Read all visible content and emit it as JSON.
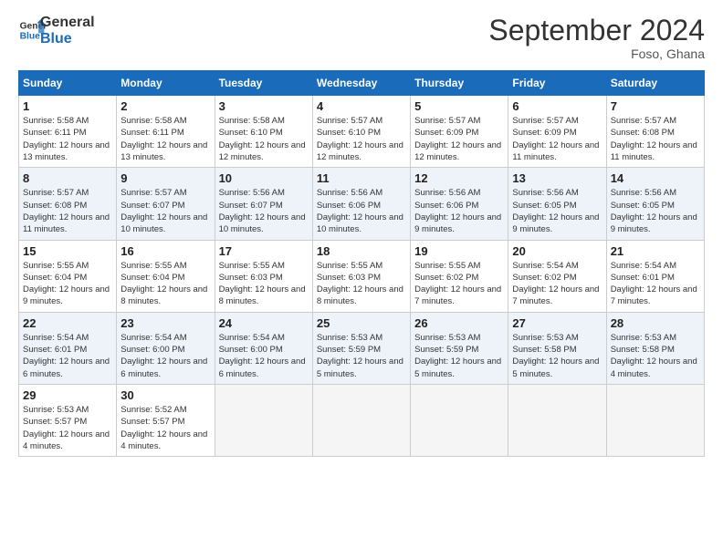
{
  "header": {
    "logo_line1": "General",
    "logo_line2": "Blue",
    "month": "September 2024",
    "location": "Foso, Ghana"
  },
  "weekdays": [
    "Sunday",
    "Monday",
    "Tuesday",
    "Wednesday",
    "Thursday",
    "Friday",
    "Saturday"
  ],
  "weeks": [
    [
      {
        "day": "1",
        "sunrise": "5:58 AM",
        "sunset": "6:11 PM",
        "daylight": "12 hours and 13 minutes."
      },
      {
        "day": "2",
        "sunrise": "5:58 AM",
        "sunset": "6:11 PM",
        "daylight": "12 hours and 13 minutes."
      },
      {
        "day": "3",
        "sunrise": "5:58 AM",
        "sunset": "6:10 PM",
        "daylight": "12 hours and 12 minutes."
      },
      {
        "day": "4",
        "sunrise": "5:57 AM",
        "sunset": "6:10 PM",
        "daylight": "12 hours and 12 minutes."
      },
      {
        "day": "5",
        "sunrise": "5:57 AM",
        "sunset": "6:09 PM",
        "daylight": "12 hours and 12 minutes."
      },
      {
        "day": "6",
        "sunrise": "5:57 AM",
        "sunset": "6:09 PM",
        "daylight": "12 hours and 11 minutes."
      },
      {
        "day": "7",
        "sunrise": "5:57 AM",
        "sunset": "6:08 PM",
        "daylight": "12 hours and 11 minutes."
      }
    ],
    [
      {
        "day": "8",
        "sunrise": "5:57 AM",
        "sunset": "6:08 PM",
        "daylight": "12 hours and 11 minutes."
      },
      {
        "day": "9",
        "sunrise": "5:57 AM",
        "sunset": "6:07 PM",
        "daylight": "12 hours and 10 minutes."
      },
      {
        "day": "10",
        "sunrise": "5:56 AM",
        "sunset": "6:07 PM",
        "daylight": "12 hours and 10 minutes."
      },
      {
        "day": "11",
        "sunrise": "5:56 AM",
        "sunset": "6:06 PM",
        "daylight": "12 hours and 10 minutes."
      },
      {
        "day": "12",
        "sunrise": "5:56 AM",
        "sunset": "6:06 PM",
        "daylight": "12 hours and 9 minutes."
      },
      {
        "day": "13",
        "sunrise": "5:56 AM",
        "sunset": "6:05 PM",
        "daylight": "12 hours and 9 minutes."
      },
      {
        "day": "14",
        "sunrise": "5:56 AM",
        "sunset": "6:05 PM",
        "daylight": "12 hours and 9 minutes."
      }
    ],
    [
      {
        "day": "15",
        "sunrise": "5:55 AM",
        "sunset": "6:04 PM",
        "daylight": "12 hours and 9 minutes."
      },
      {
        "day": "16",
        "sunrise": "5:55 AM",
        "sunset": "6:04 PM",
        "daylight": "12 hours and 8 minutes."
      },
      {
        "day": "17",
        "sunrise": "5:55 AM",
        "sunset": "6:03 PM",
        "daylight": "12 hours and 8 minutes."
      },
      {
        "day": "18",
        "sunrise": "5:55 AM",
        "sunset": "6:03 PM",
        "daylight": "12 hours and 8 minutes."
      },
      {
        "day": "19",
        "sunrise": "5:55 AM",
        "sunset": "6:02 PM",
        "daylight": "12 hours and 7 minutes."
      },
      {
        "day": "20",
        "sunrise": "5:54 AM",
        "sunset": "6:02 PM",
        "daylight": "12 hours and 7 minutes."
      },
      {
        "day": "21",
        "sunrise": "5:54 AM",
        "sunset": "6:01 PM",
        "daylight": "12 hours and 7 minutes."
      }
    ],
    [
      {
        "day": "22",
        "sunrise": "5:54 AM",
        "sunset": "6:01 PM",
        "daylight": "12 hours and 6 minutes."
      },
      {
        "day": "23",
        "sunrise": "5:54 AM",
        "sunset": "6:00 PM",
        "daylight": "12 hours and 6 minutes."
      },
      {
        "day": "24",
        "sunrise": "5:54 AM",
        "sunset": "6:00 PM",
        "daylight": "12 hours and 6 minutes."
      },
      {
        "day": "25",
        "sunrise": "5:53 AM",
        "sunset": "5:59 PM",
        "daylight": "12 hours and 5 minutes."
      },
      {
        "day": "26",
        "sunrise": "5:53 AM",
        "sunset": "5:59 PM",
        "daylight": "12 hours and 5 minutes."
      },
      {
        "day": "27",
        "sunrise": "5:53 AM",
        "sunset": "5:58 PM",
        "daylight": "12 hours and 5 minutes."
      },
      {
        "day": "28",
        "sunrise": "5:53 AM",
        "sunset": "5:58 PM",
        "daylight": "12 hours and 4 minutes."
      }
    ],
    [
      {
        "day": "29",
        "sunrise": "5:53 AM",
        "sunset": "5:57 PM",
        "daylight": "12 hours and 4 minutes."
      },
      {
        "day": "30",
        "sunrise": "5:52 AM",
        "sunset": "5:57 PM",
        "daylight": "12 hours and 4 minutes."
      },
      null,
      null,
      null,
      null,
      null
    ]
  ]
}
